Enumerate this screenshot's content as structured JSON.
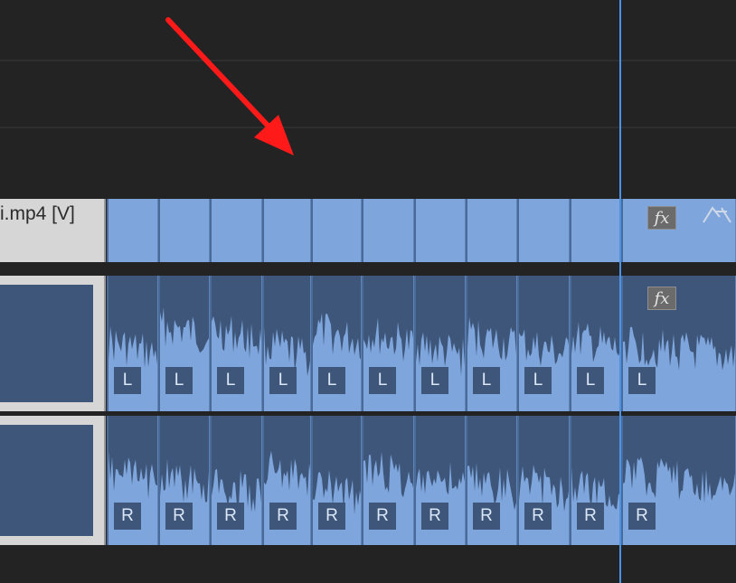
{
  "timeline": {
    "video_track": {
      "clip_name": "i.mp4 [V]",
      "fx_label": "fx",
      "keyframe_icon": "keyframe-icon"
    },
    "audio_track_left": {
      "channel_label": "L",
      "fx_label": "fx",
      "labels": [
        "L",
        "L",
        "L",
        "L",
        "L",
        "L",
        "L",
        "L",
        "L",
        "L",
        "L"
      ]
    },
    "audio_track_right": {
      "channel_label": "R",
      "labels": [
        "R",
        "R",
        "R",
        "R",
        "R",
        "R",
        "R",
        "R",
        "R",
        "R",
        "R"
      ]
    },
    "colors": {
      "clip_blue": "#7ea5dc",
      "waveform_dark": "#3d5679",
      "playhead": "#4a93e6",
      "annotation_arrow": "#ff1a1a",
      "background": "#232323"
    }
  }
}
